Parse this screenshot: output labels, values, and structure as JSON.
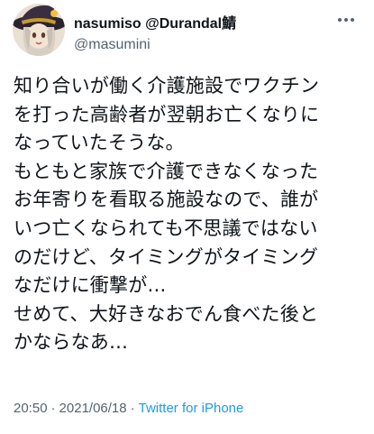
{
  "tweet": {
    "author": {
      "display_name": "nasumiso @Durandal鯖",
      "handle": "@masumini",
      "avatar_icon": "witch-avatar-icon"
    },
    "more_icon": "more-options-icon",
    "body_lines": [
      "知り合いが働く介護施設でワクチン",
      "を打った高齢者が翌朝お亡くなりに",
      "なっていたそうな。",
      "もともと家族で介護できなくなった",
      "お年寄りを看取る施設なので、誰が",
      "いつ亡くなられても不思議ではない",
      "のだけど、タイミングがタイミング",
      "なだけに衝撃が…",
      "せめて、大好きなおでん食べた後と",
      "かならなあ…"
    ],
    "time": "20:50",
    "date": "2021/06/18",
    "separator": "·",
    "source": "Twitter for iPhone"
  },
  "colors": {
    "text": "#0f1419",
    "secondary": "#536471",
    "link": "#1d9bf0",
    "background": "#ffffff"
  }
}
